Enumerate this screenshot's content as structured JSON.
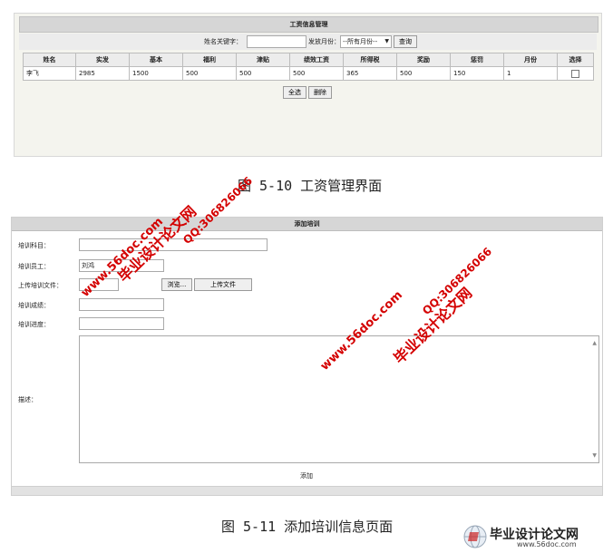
{
  "salary_panel": {
    "title": "工资信息管理",
    "search_label": "姓名关键字：",
    "search_value": "",
    "month_label": "发放月份：",
    "month_selected": "--所有月份--",
    "query_button": "查询",
    "columns": [
      "姓名",
      "实发",
      "基本",
      "福利",
      "津贴",
      "绩效工资",
      "所得税",
      "奖励",
      "惩罚",
      "月份",
      "选择"
    ],
    "rows": [
      {
        "name": "李飞",
        "net": "2985",
        "base": "1500",
        "welfare": "500",
        "allowance": "500",
        "performance": "500",
        "tax": "365",
        "reward": "500",
        "penalty": "150",
        "month": "1"
      }
    ],
    "select_all_button": "全选",
    "delete_button": "删除"
  },
  "caption1": "图 5-10 工资管理界面",
  "training_panel": {
    "title": "添加培训",
    "subject_label": "培训科目：",
    "subject_value": "",
    "employee_label": "培训员工：",
    "employee_value": "刘鸿",
    "file_label": "上传培训文件：",
    "file_value": "",
    "browse_button": "浏览...",
    "upload_button": "上传文件",
    "score_label": "培训成绩：",
    "score_value": "",
    "progress_label": "培训进度：",
    "progress_value": "",
    "desc_label": "描述：",
    "desc_value": "",
    "submit_label": "添加"
  },
  "caption2": "图 5-11 添加培训信息页面",
  "watermark": {
    "site_text": "毕业设计论文网",
    "url": "www.56doc.com",
    "qq": "QQ:306826066",
    "color": "#d40000"
  },
  "footer_logo": {
    "text": "毕业设计论文网",
    "url": "www.56doc.com"
  }
}
